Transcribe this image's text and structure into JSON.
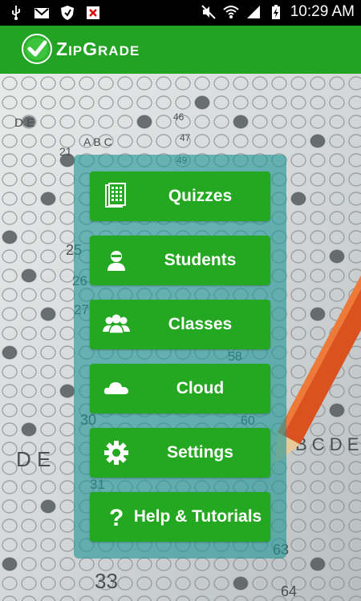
{
  "status_bar": {
    "time": "10:29 AM",
    "icons": [
      "usb-icon",
      "gmail-icon",
      "shield-icon",
      "close-box-icon",
      "mute-icon",
      "wifi-icon",
      "signal-icon",
      "battery-charging-icon"
    ]
  },
  "app": {
    "title_cap": "Z",
    "title_rest_1": "IP",
    "title_cap_2": "G",
    "title_rest_2": "RADE"
  },
  "menu": [
    {
      "label": "Quizzes",
      "icon": "quiz-icon"
    },
    {
      "label": "Students",
      "icon": "student-icon"
    },
    {
      "label": "Classes",
      "icon": "classes-icon"
    },
    {
      "label": "Cloud",
      "icon": "cloud-icon"
    },
    {
      "label": "Settings",
      "icon": "gear-icon"
    },
    {
      "label": "Help & Tutorials",
      "icon": "question-icon"
    }
  ],
  "colors": {
    "app_bar": "#22a323",
    "button": "#24a821",
    "panel": "#1e9696"
  }
}
